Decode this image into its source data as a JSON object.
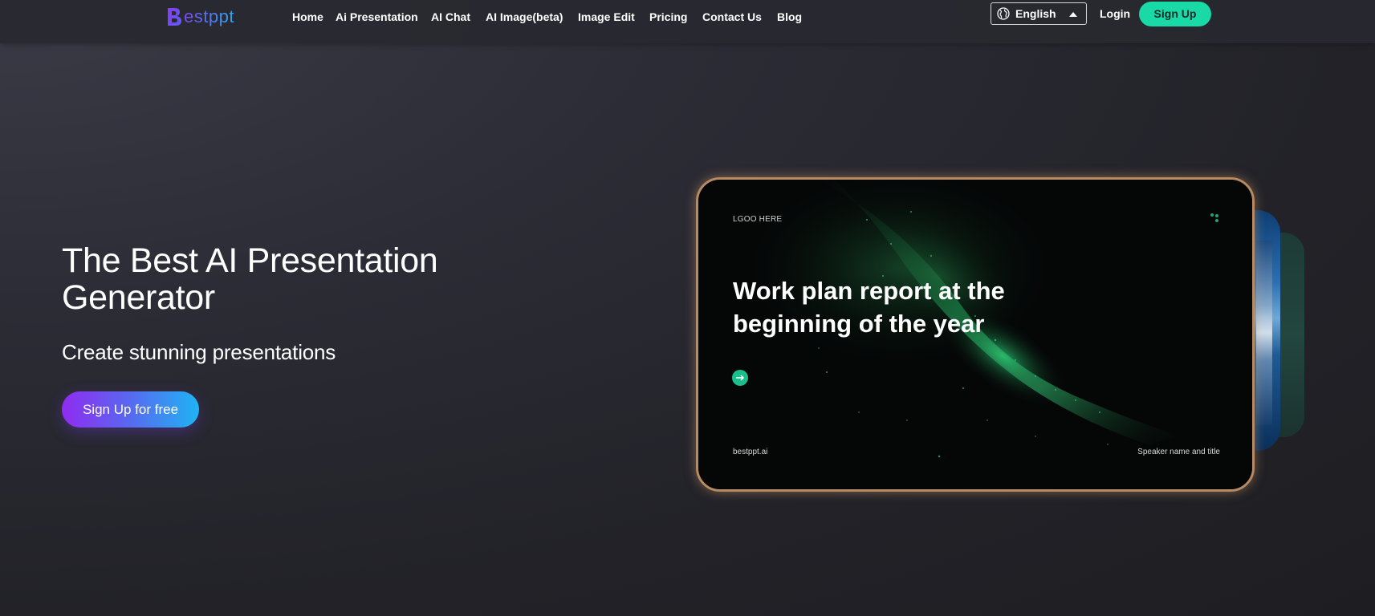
{
  "header": {
    "logo_text": "estppt",
    "logo_letter": "B",
    "nav": [
      {
        "label": "Home"
      },
      {
        "label": "Ai Presentation"
      },
      {
        "label": "AI Chat"
      },
      {
        "label": "AI Image(beta)"
      },
      {
        "label": "Image Edit"
      },
      {
        "label": "Pricing"
      },
      {
        "label": "Contact Us"
      },
      {
        "label": "Blog"
      }
    ],
    "language": {
      "selected": "English",
      "icon": "globe-icon"
    },
    "login_label": "Login",
    "signup_label": "Sign Up"
  },
  "hero": {
    "title": "The Best AI Presentation Generator",
    "subtitle": "Create stunning presentations",
    "cta_label": "Sign Up for free"
  },
  "slide_preview": {
    "logo_placeholder": "LGOO HERE",
    "title": "Work plan report at the beginning of the year",
    "url": "bestppt.ai",
    "speaker": "Speaker name and title",
    "arrow_icon": "arrow-right-icon",
    "dots_icon": "dots-icon"
  },
  "colors": {
    "accent_green": "#19d9a6",
    "cta_gradient_start": "#8f2cf0",
    "cta_gradient_end": "#1fb4f2",
    "logo_gradient_start": "#7a48f2",
    "logo_gradient_end": "#2ea6f0",
    "slide_border": "#b88a62"
  }
}
